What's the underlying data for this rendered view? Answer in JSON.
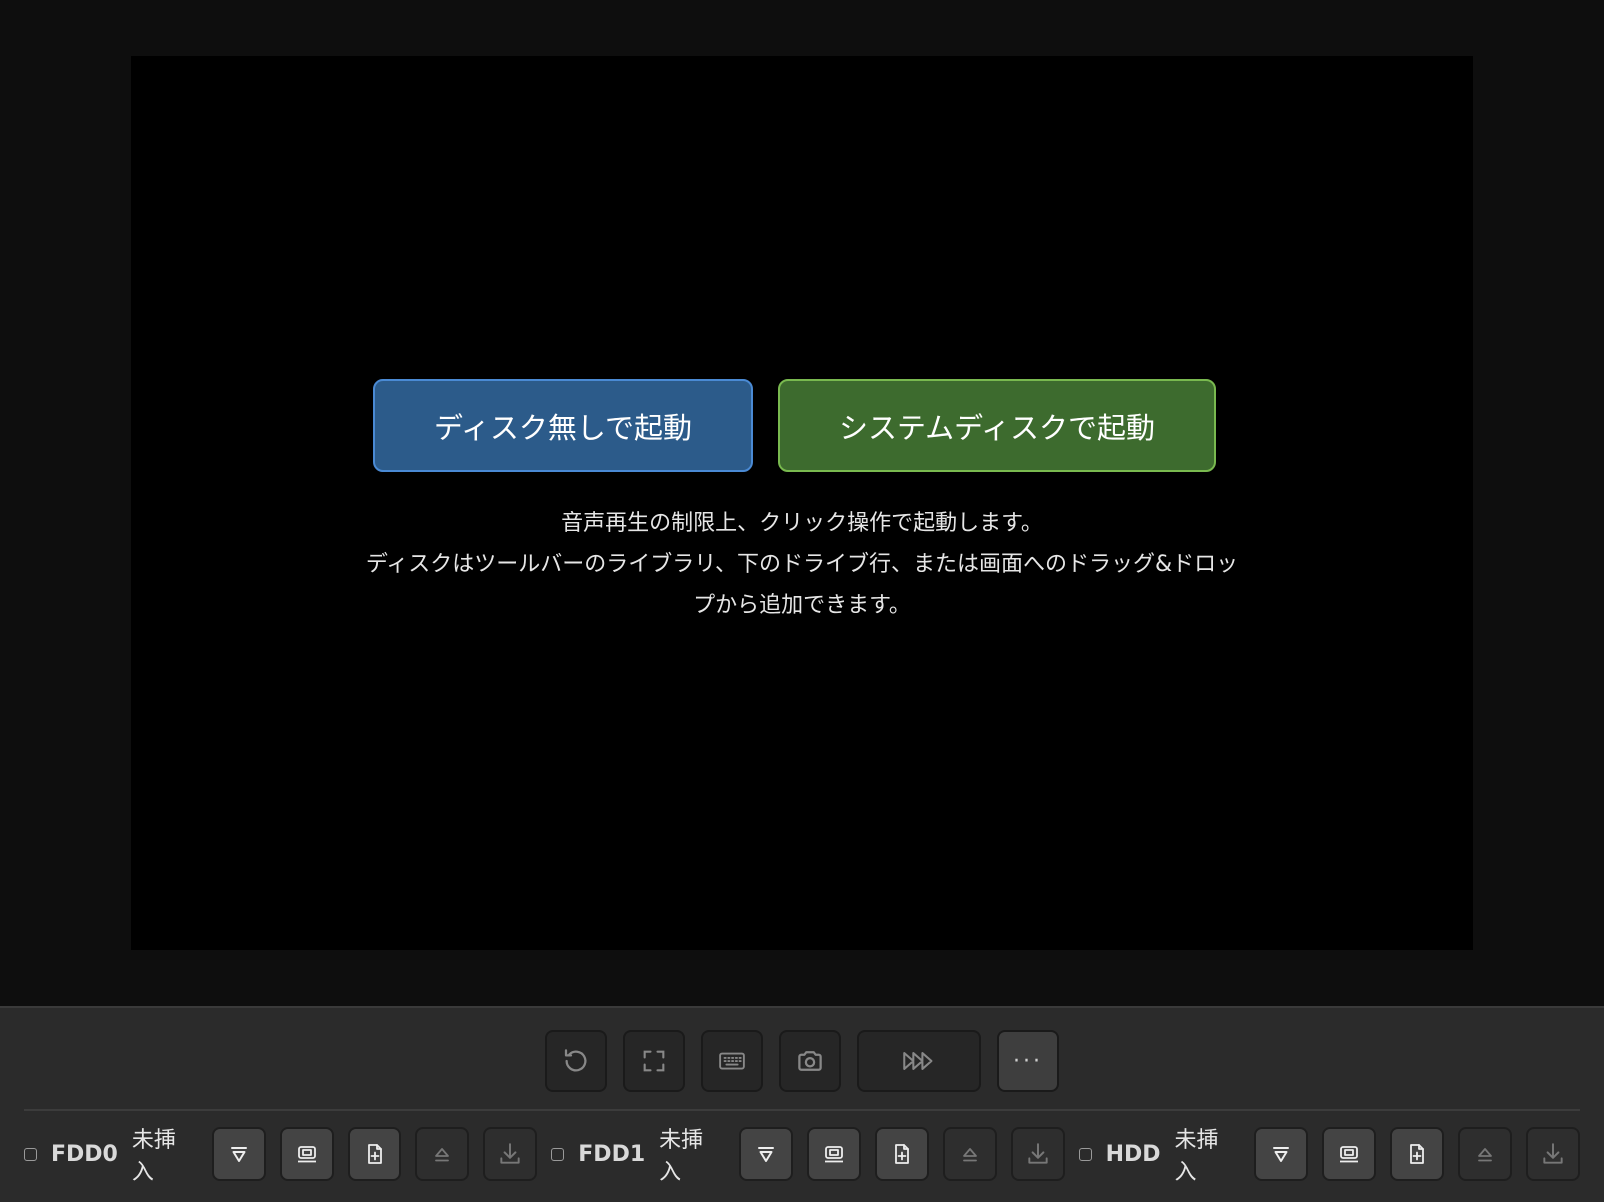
{
  "boot": {
    "no_disk_label": "ディスク無しで起動",
    "system_disk_label": "システムディスクで起動"
  },
  "hint": {
    "line1": "音声再生の制限上、クリック操作で起動します。",
    "line2": "ディスクはツールバーのライブラリ、下のドライブ行、または画面へのドラッグ&ドロッ",
    "line3": "プから追加できます。"
  },
  "toolbar": {
    "items": [
      "reset-icon",
      "fullscreen-icon",
      "keyboard-icon",
      "camera-icon",
      "fast-forward-icon"
    ],
    "more_label": "···"
  },
  "drives": [
    {
      "name": "FDD0",
      "status": "未挿入"
    },
    {
      "name": "FDD1",
      "status": "未挿入"
    },
    {
      "name": "HDD",
      "status": "未挿入"
    }
  ],
  "colors": {
    "background": "#0e0e0e",
    "screen": "#000000",
    "no_disk_button": "#2c5b8a",
    "system_disk_button": "#3d6b2e",
    "bar": "#2b2b2b"
  }
}
